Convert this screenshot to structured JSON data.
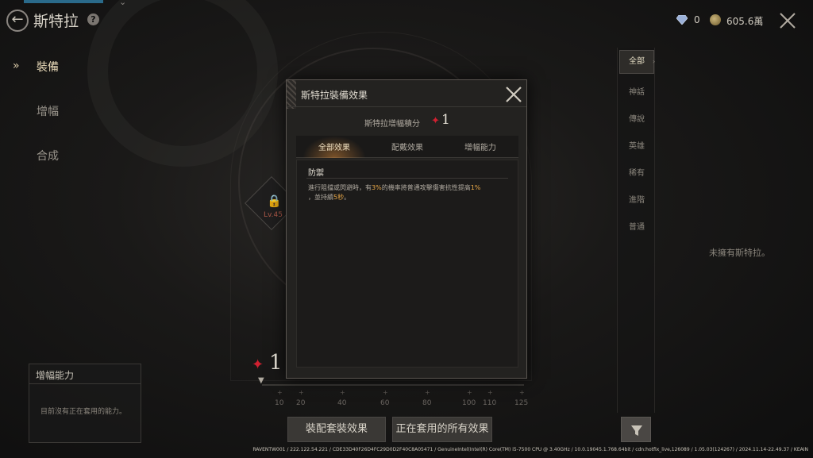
{
  "header": {
    "title": "斯特拉",
    "help_icon": "question-circle-icon",
    "back_icon": "back-arrow-icon",
    "diamond_count": "0",
    "gold_count": "605.6萬"
  },
  "left_nav": {
    "items": [
      {
        "label": "裝備",
        "active": true
      },
      {
        "label": "增幅",
        "active": false
      },
      {
        "label": "合成",
        "active": false
      }
    ]
  },
  "ability_panel": {
    "title": "增幅能力",
    "empty_text": "目前沒有正在套用的能力。"
  },
  "locked_slot": {
    "level": "Lv.45"
  },
  "progress": {
    "score": "1",
    "ticks": [
      "10",
      "20",
      "40",
      "60",
      "80",
      "100",
      "110",
      "125"
    ]
  },
  "buttons": {
    "equip_set_effect": "裝配套裝效果",
    "all_active_effects": "正在套用的所有效果"
  },
  "categories": [
    {
      "label": "全部",
      "active": true
    },
    {
      "label": "神話",
      "active": false
    },
    {
      "label": "傳說",
      "active": false
    },
    {
      "label": "英雄",
      "active": false
    },
    {
      "label": "稀有",
      "active": false
    },
    {
      "label": "進階",
      "active": false
    },
    {
      "label": "普通",
      "active": false
    }
  ],
  "empty_right": "未擁有斯特拉。",
  "modal": {
    "title": "斯特拉裝備效果",
    "score_label": "斯特拉增幅積分",
    "score_value": "1",
    "tabs": [
      {
        "label": "全部效果",
        "active": true
      },
      {
        "label": "配戴效果",
        "active": false
      },
      {
        "label": "增幅能力",
        "active": false
      }
    ],
    "effect": {
      "heading": "防禦",
      "text_1": "進行阻擋或閃避時，有",
      "pct_1": "3%",
      "text_2": "的機率將普通攻擊傷害抗性提高",
      "pct_2": "1%",
      "text_3": "，並持續",
      "dur": "5秒",
      "text_4": "。"
    }
  },
  "debug": "RAVENTW001 / 222.122.54.221 / CDE33D40F26D4FC29D0D2F40C8A05471 / GenuineIntel(Intel(R) Core(TM) i5-7500 CPU @ 3.40GHz / 10.0.19045.1.768.64bit / cdn:hotfix_live,126089 / 1.05.03(124267) / 2024.11.14-22.49.37 / KEAIN"
}
